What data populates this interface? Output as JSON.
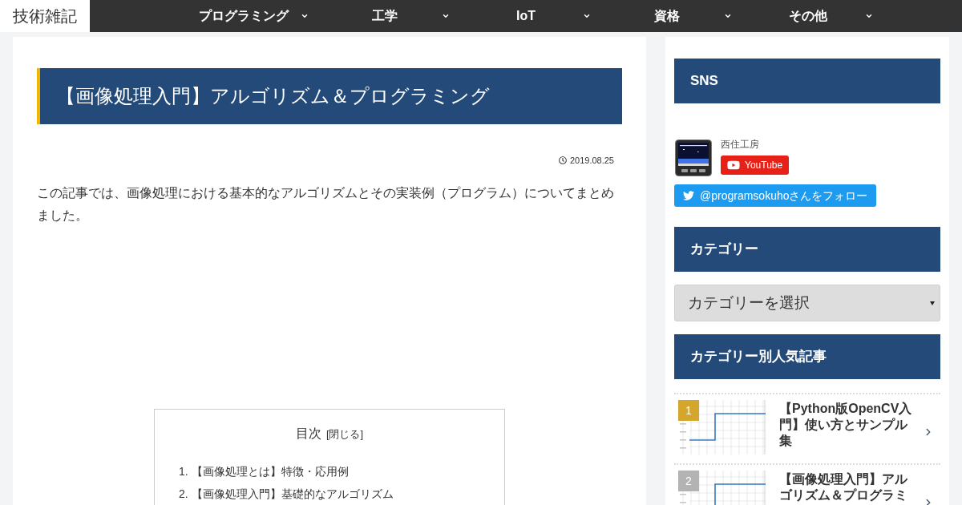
{
  "header": {
    "logo": "技術雑記",
    "nav": [
      "プログラミング",
      "工学",
      "IoT",
      "資格",
      "その他"
    ]
  },
  "article": {
    "title": "【画像処理入門】アルゴリズム＆プログラミング",
    "date": "2019.08.25",
    "intro": "この記事では、画像処理における基本的なアルゴリズムとその実装例（プログラム）についてまとめました。",
    "toc": {
      "title": "目次",
      "toggle": "[閉じる]",
      "items": [
        {
          "num": "1.",
          "text": "【画像処理とは】特徴・応用例"
        },
        {
          "num": "2.",
          "text": "【画像処理入門】基礎的なアルゴリズム"
        }
      ]
    }
  },
  "sidebar": {
    "sns": {
      "heading": "SNS",
      "channel_name": "西住工房",
      "youtube_button": "YouTube",
      "twitter_button": "@programsokuhoさんをフォロー"
    },
    "categories": {
      "heading": "カテゴリー",
      "select": {
        "value": "カテゴリーを選択"
      }
    },
    "popular": {
      "heading": "カテゴリー別人気記事",
      "items": [
        {
          "rank": "1",
          "color": "#d4a72c",
          "title": "【Python版OpenCV入門】使い方とサンプル集"
        },
        {
          "rank": "2",
          "color": "#b3b3b3",
          "title": "【画像処理入門】アルゴリズム＆プログラミ"
        }
      ]
    }
  }
}
